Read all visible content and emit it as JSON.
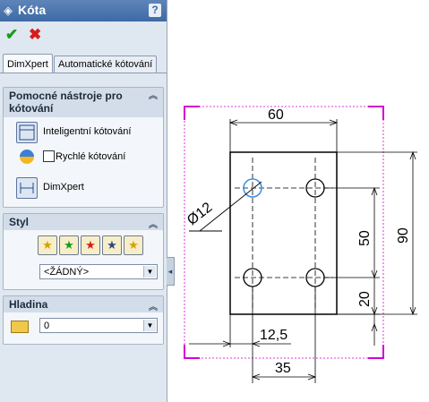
{
  "panel": {
    "title": "Kóta",
    "help_label": "?",
    "ok_label": "✔",
    "cancel_label": "✖",
    "tabs": [
      {
        "label": "DimXpert",
        "active": true
      },
      {
        "label": "Automatické kótování",
        "active": false
      }
    ],
    "helpers": {
      "title": "Pomocné nástroje pro kótování",
      "items": [
        {
          "label": "Inteligentní kótování"
        },
        {
          "label": "Rychlé kótování",
          "checked": false
        },
        {
          "label": "DimXpert"
        }
      ]
    },
    "style": {
      "title": "Styl",
      "selected": "<ŽÁDNÝ>"
    },
    "layer": {
      "title": "Hladina",
      "selected": "0"
    }
  },
  "drawing": {
    "dimensions": {
      "top": "60",
      "diameter": "12",
      "right_inner": "50",
      "right_outer": "90",
      "right_lower": "20",
      "bottom_inner": "12,5",
      "bottom_outer": "35"
    }
  },
  "colors": {
    "accent": "#3d6aa6",
    "selection_frame": "#d400d4",
    "selected_hole": "#3a8ee6"
  }
}
